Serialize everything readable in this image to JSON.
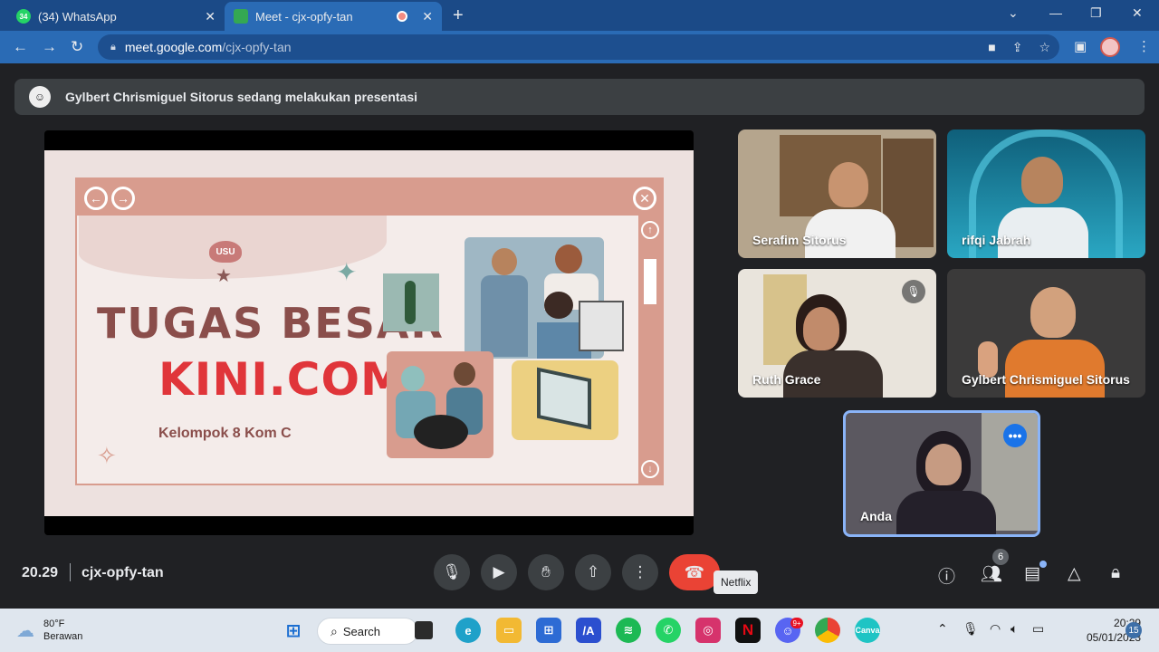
{
  "browser": {
    "tabs": [
      {
        "title": "(34) WhatsApp",
        "favicon_text": "34",
        "favicon_color": "#25d366"
      },
      {
        "title": "Meet - cjx-opfy-tan",
        "favicon_color": "#34a853"
      }
    ],
    "url_domain": "meet.google.com",
    "url_path": "/cjx-opfy-tan"
  },
  "meet": {
    "presenting_banner": "Gylbert Chrismiguel Sitorus sedang melakukan presentasi",
    "slide": {
      "logo_text": "USU",
      "title_line1": "TUGAS BESAR",
      "title_line2": "KINI.COM",
      "subtitle": "Kelompok 8 Kom C"
    },
    "participants": [
      {
        "name": "Serafim Sitorus"
      },
      {
        "name": "rifqi Jabrah"
      },
      {
        "name": "Ruth Grace",
        "muted": true
      },
      {
        "name": "Gylbert Chrismiguel Sitorus"
      },
      {
        "name": "Anda",
        "self": true
      }
    ],
    "time": "20.29",
    "meeting_code": "cjx-opfy-tan",
    "participant_count": "6",
    "tooltip": "Netflix",
    "colors": {
      "hangup": "#ea4335",
      "accent": "#8ab4f8",
      "background": "#202124"
    }
  },
  "taskbar": {
    "weather_temp": "80°F",
    "weather_desc": "Berawan",
    "search_label": "Search",
    "clock_time": "20:29",
    "clock_date": "05/01/2023",
    "notification_count": "15",
    "discord_badge": "9+"
  }
}
